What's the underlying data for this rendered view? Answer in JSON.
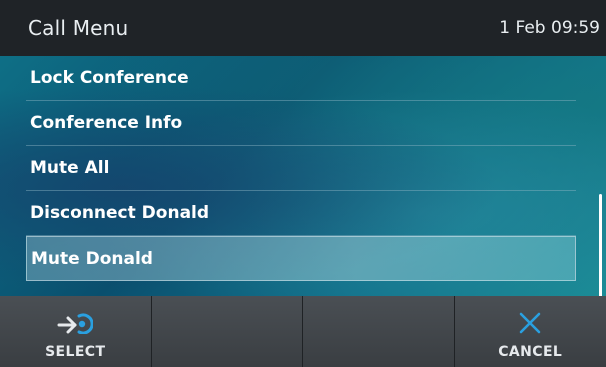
{
  "header": {
    "title": "Call Menu",
    "datetime": "1 Feb 09:59"
  },
  "menu": {
    "items": [
      {
        "label": "Lock Conference",
        "selected": false
      },
      {
        "label": "Conference Info",
        "selected": false
      },
      {
        "label": "Mute All",
        "selected": false
      },
      {
        "label": "Disconnect Donald",
        "selected": false
      },
      {
        "label": "Mute Donald",
        "selected": true
      }
    ]
  },
  "softkeys": [
    {
      "label": "SELECT",
      "icon": "select-arrow-icon"
    },
    {
      "label": "",
      "icon": ""
    },
    {
      "label": "",
      "icon": ""
    },
    {
      "label": "CANCEL",
      "icon": "close-icon"
    }
  ],
  "colors": {
    "header_bg": "#1f2327",
    "accent": "#2aa0e0",
    "softkey_bg": "#444a4f"
  }
}
